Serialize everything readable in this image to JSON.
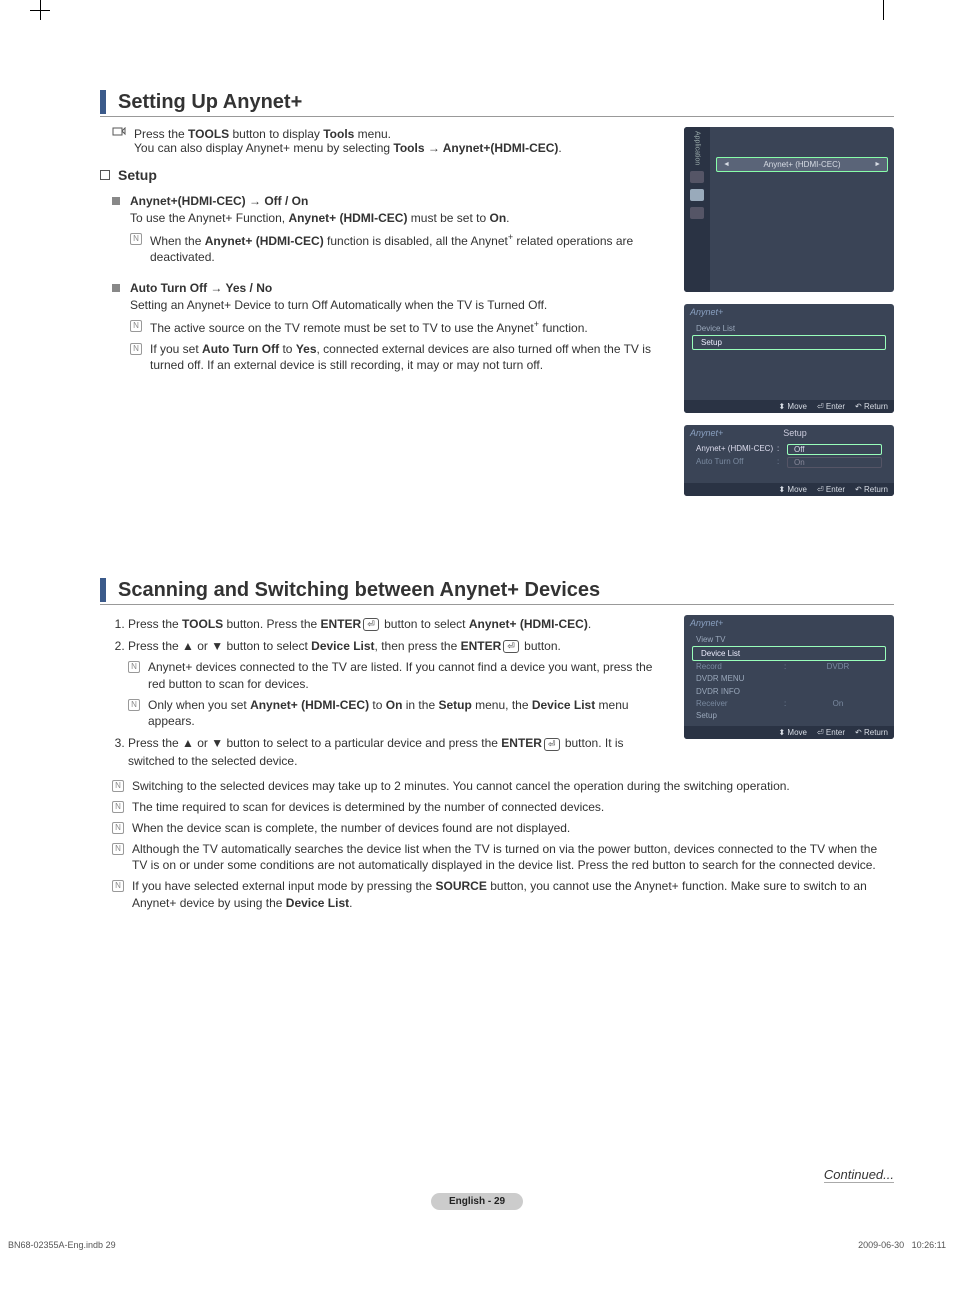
{
  "section1": {
    "title": "Setting Up Anynet+",
    "tip": {
      "line1_pre": "Press the ",
      "line1_b": "TOOLS",
      "line1_mid": " button to display ",
      "line1_b2": "Tools",
      "line1_post": " menu.",
      "line2_pre": "You can also display Anynet+ menu by selecting ",
      "line2_b": "Tools → Anynet+(HDMI-CEC)",
      "line2_post": "."
    },
    "sub_heading": "Setup",
    "item1": {
      "heading": "Anynet+(HDMI-CEC) → Off / On",
      "desc_pre": "To use the Anynet+ Function, ",
      "desc_b": "Anynet+ (HDMI-CEC)",
      "desc_mid": " must be set to ",
      "desc_b2": "On",
      "desc_post": ".",
      "note_pre": "When the ",
      "note_b": "Anynet+ (HDMI-CEC)",
      "note_post": " function is disabled, all the Anynet",
      "note_sup": "+",
      "note_tail": " related operations are deactivated."
    },
    "item2": {
      "heading": "Auto Turn Off → Yes / No",
      "desc": "Setting an Anynet+ Device to turn Off Automatically when the TV is Turned Off.",
      "note1_pre": "The active source on the TV remote must be set to TV to use the Anynet",
      "note1_sup": "+",
      "note1_post": " function.",
      "note2_pre": "If you set ",
      "note2_b": "Auto Turn Off",
      "note2_mid": " to ",
      "note2_b2": "Yes",
      "note2_post": ", connected external devices are also turned off when the TV is turned off. If an external device is still recording, it may or may not turn off."
    }
  },
  "osd1": {
    "side_label": "Application",
    "sel": "Anynet+ (HDMI-CEC)"
  },
  "osd2": {
    "title": "Anynet+",
    "row1": "Device List",
    "row2": "Setup",
    "foot_move": "Move",
    "foot_enter": "Enter",
    "foot_return": "Return"
  },
  "osd3": {
    "brand": "Anynet+",
    "title": "Setup",
    "r1k": "Anynet+ (HDMI-CEC)",
    "r1v": "Off",
    "r2k": "Auto Turn Off",
    "r2v": "On",
    "foot_move": "Move",
    "foot_enter": "Enter",
    "foot_return": "Return"
  },
  "section2": {
    "title": "Scanning and Switching between Anynet+ Devices",
    "step1_pre": "Press the ",
    "step1_b1": "TOOLS",
    "step1_mid": " button. Press the ",
    "step1_b2": "ENTER",
    "step1_mid2": " button to select ",
    "step1_b3": "Anynet+ (HDMI-CEC)",
    "step1_post": ".",
    "step2_pre": "Press the ▲ or ▼ button to select ",
    "step2_b1": "Device List",
    "step2_mid": ", then press the ",
    "step2_b2": "ENTER",
    "step2_post": " button.",
    "step2_note1": "Anynet+ devices connected to the TV are listed. If you cannot find a device you want, press the red button to scan for devices.",
    "step2_note2_pre": "Only when you set ",
    "step2_note2_b1": "Anynet+ (HDMI-CEC)",
    "step2_note2_mid": " to ",
    "step2_note2_b2": "On",
    "step2_note2_mid2": " in the ",
    "step2_note2_b3": "Setup",
    "step2_note2_mid3": " menu, the ",
    "step2_note2_b4": "Device List",
    "step2_note2_post": " menu appears.",
    "step3_pre": "Press the ▲ or ▼ button to select to a particular device and press the ",
    "step3_b": "ENTER",
    "step3_post": " button. It is switched to the selected device.",
    "gnote1": "Switching to the selected devices may take up to 2 minutes. You cannot cancel the operation during the switching operation.",
    "gnote2": "The time required to scan for devices is determined by the number of connected devices.",
    "gnote3": "When the device scan is complete, the number of devices found are not displayed.",
    "gnote4": "Although the TV automatically searches the device list when the TV is turned on via the power button, devices connected to the TV when the TV is on or under some conditions are not automatically displayed in the device list. Press the red button to search for the connected device.",
    "gnote5_pre": "If you have selected external input mode by pressing the ",
    "gnote5_b1": "SOURCE",
    "gnote5_mid": " button, you cannot use the Anynet+ function. Make sure to switch to an Anynet+ device by using the ",
    "gnote5_b2": "Device List",
    "gnote5_post": "."
  },
  "osd4": {
    "title": "Anynet+",
    "rows": {
      "r1": "View TV",
      "r2": "Device List",
      "r3k": "Record",
      "r3v": "DVDR",
      "r4": "DVDR MENU",
      "r5": "DVDR INFO",
      "r6k": "Receiver",
      "r6v": "On",
      "r7": "Setup"
    },
    "foot_move": "Move",
    "foot_enter": "Enter",
    "foot_return": "Return"
  },
  "footer": {
    "continued": "Continued...",
    "pill": "English - 29",
    "indb_left": "BN68-02355A-Eng.indb   29",
    "indb_date": "2009-06-30",
    "indb_time": "   10:26:11"
  }
}
